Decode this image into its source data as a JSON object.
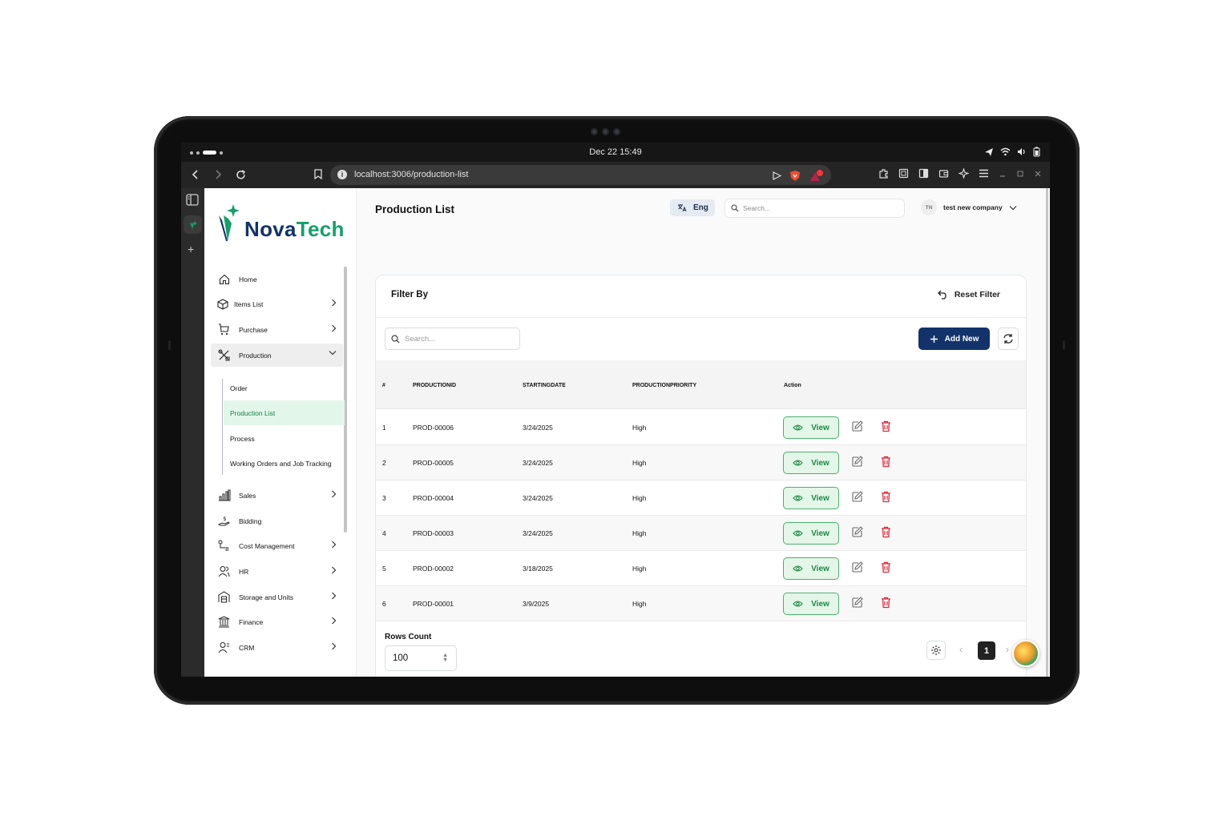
{
  "os": {
    "clock": "Dec 22  15:49"
  },
  "browser": {
    "url": "localhost:3006/production-list"
  },
  "brand": {
    "part1": "Nova",
    "part2": "Tech",
    "green": "#14a06a",
    "navy": "#12336a"
  },
  "sidebar": {
    "items": [
      {
        "label": "Home",
        "icon": "home-icon",
        "chevron": false
      },
      {
        "label": "Items List",
        "icon": "box-icon",
        "chevron": true
      },
      {
        "label": "Purchase",
        "icon": "cart-icon",
        "chevron": true
      },
      {
        "label": "Production",
        "icon": "tools-icon",
        "chevron": true,
        "expanded": true
      },
      {
        "label": "Sales",
        "icon": "bar-chart-icon",
        "chevron": true
      },
      {
        "label": "Bidding",
        "icon": "hand-dollar-icon",
        "chevron": false
      },
      {
        "label": "Cost Management",
        "icon": "cost-flow-icon",
        "chevron": true
      },
      {
        "label": "HR",
        "icon": "users-icon",
        "chevron": true
      },
      {
        "label": "Storage and Units",
        "icon": "warehouse-icon",
        "chevron": true
      },
      {
        "label": "Finance",
        "icon": "bank-icon",
        "chevron": true
      },
      {
        "label": "CRM",
        "icon": "contacts-icon",
        "chevron": true
      }
    ],
    "production_sub": [
      {
        "label": "Order"
      },
      {
        "label": "Production List",
        "active": true
      },
      {
        "label": "Process"
      },
      {
        "label": "Working Orders and Job Tracking"
      }
    ]
  },
  "header": {
    "title": "Production List",
    "lang": "Eng",
    "search_placeholder": "Search...",
    "avatar_initials": "TN",
    "company": "test new company"
  },
  "filter": {
    "title": "Filter By",
    "reset_label": "Reset Filter",
    "search_placeholder": "Search...",
    "add_label": "Add New"
  },
  "table": {
    "columns": [
      "#",
      "PRODUCTIONID",
      "STARTINGDATE",
      "PRODUCTIONPRIORITY",
      "Action"
    ],
    "view_label": "View",
    "rows": [
      {
        "n": "1",
        "id": "PROD-00006",
        "date": "3/24/2025",
        "priority": "High"
      },
      {
        "n": "2",
        "id": "PROD-00005",
        "date": "3/24/2025",
        "priority": "High"
      },
      {
        "n": "3",
        "id": "PROD-00004",
        "date": "3/24/2025",
        "priority": "High"
      },
      {
        "n": "4",
        "id": "PROD-00003",
        "date": "3/24/2025",
        "priority": "High"
      },
      {
        "n": "5",
        "id": "PROD-00002",
        "date": "3/18/2025",
        "priority": "High"
      },
      {
        "n": "6",
        "id": "PROD-00001",
        "date": "3/9/2025",
        "priority": "High"
      }
    ]
  },
  "pagination": {
    "rows_label": "Rows Count",
    "rows_value": "100",
    "current_page": "1"
  }
}
